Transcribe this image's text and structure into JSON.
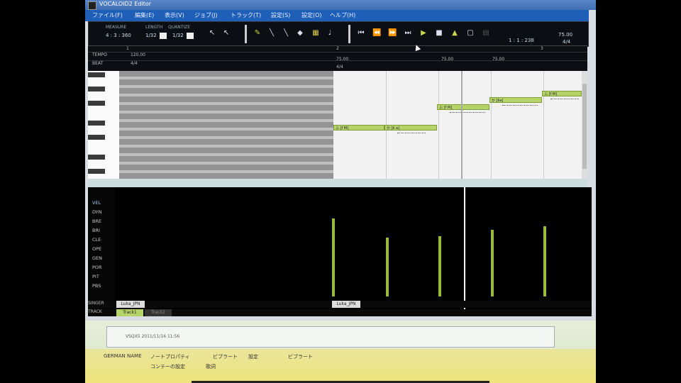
{
  "window": {
    "title": "VOCALOID2 Editor",
    "menus": [
      "ファイル(F)",
      "編集(E)",
      "表示(V)",
      "ジョブ(J)",
      "トラック(T)",
      "設定(S)",
      "設定(O)",
      "ヘルプ(H)"
    ]
  },
  "toolbar": {
    "measure_label": "MEASURE",
    "measure_value": "4 : 3 : 360",
    "length_label": "LENGTH",
    "length_value": "1/32",
    "quantize_label": "QUANTIZE",
    "quantize_value": "1/32",
    "position_value": "1 : 1 : 238",
    "tempo_value": "75.00",
    "beat_value": "4/4",
    "icons": [
      "arrow-icon",
      "arrow-select-icon",
      "pencil-icon",
      "line-icon",
      "eraser-icon",
      "grid-icon",
      "note-icon",
      "rewind-icon",
      "back-icon",
      "forward-icon",
      "end-icon",
      "play-icon",
      "stop-icon",
      "record-icon",
      "loop-icon",
      "metronome-icon"
    ]
  },
  "ruler": {
    "tempo_label": "TEMPO",
    "beat_label": "BEAT",
    "tempo_values": [
      "120.00",
      "75.00",
      "75.00",
      "75.00"
    ],
    "beat_values": [
      "4/4",
      "4/4"
    ],
    "bar_numbers": [
      "1",
      "2",
      "3"
    ]
  },
  "notes": [
    {
      "text": "ふ [f M]"
    },
    {
      "text": "か [k a]"
    },
    {
      "text": "ふ [f M]"
    },
    {
      "text": "か [ka]"
    },
    {
      "text": "ふ [f M]"
    }
  ],
  "control_params": [
    "VEL",
    "DYN",
    "BRE",
    "BRI",
    "CLE",
    "OPE",
    "GEN",
    "POR",
    "PIT",
    "PBS"
  ],
  "velocity_values": [
    100,
    75,
    77,
    85,
    90
  ],
  "track_area": {
    "singer_label": "SINGER",
    "track_label": "TRACK",
    "singer_values": [
      "Luka_JPN",
      "Luka_JPN"
    ],
    "tabs": [
      "Track1",
      "Track2"
    ]
  },
  "popup": {
    "text": "VSQX5 2011/11/16 11:56"
  },
  "taskbar_items": [
    "GERMAN NAME",
    "ノートプロパティ",
    "ビブラート",
    "設定",
    "ビブラート",
    "コンテーの設定",
    "歌詞"
  ]
}
